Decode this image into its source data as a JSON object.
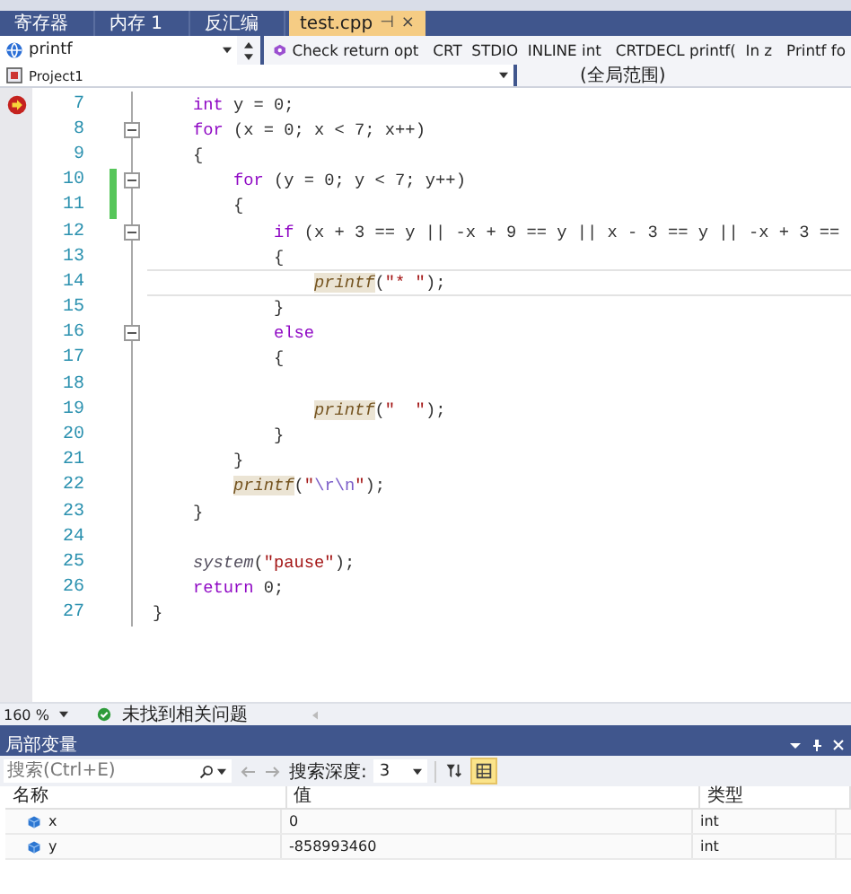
{
  "doc_tabs": [
    {
      "label": "寄存器",
      "selected": false
    },
    {
      "label": "内存 1",
      "selected": false
    },
    {
      "label": "反汇编",
      "selected": false
    },
    {
      "label": "test.cpp",
      "selected": true,
      "pin": "⊣",
      "close": "×"
    }
  ],
  "nav_bar": {
    "member": "printf",
    "signature": "Check return opt   CRT  STDIO  INLINE int   CRTDECL printf(  In z   Printf fo",
    "project": "Project1",
    "scope": "(全局范围)"
  },
  "code_lines": [
    {
      "number": "7",
      "next_statement": true,
      "fold": false,
      "modified": false,
      "current": false,
      "tokens": [
        {
          "kind": "kw",
          "text": "    int"
        },
        {
          "kind": "plain",
          "text": " y = 0;"
        }
      ]
    },
    {
      "number": "8",
      "next_statement": false,
      "fold": true,
      "modified": false,
      "current": false,
      "tokens": [
        {
          "kind": "kw",
          "text": "    for"
        },
        {
          "kind": "plain",
          "text": " (x = 0; x < 7; x++)"
        }
      ]
    },
    {
      "number": "9",
      "next_statement": false,
      "fold": false,
      "modified": false,
      "current": false,
      "tokens": [
        {
          "kind": "plain",
          "text": "    {"
        }
      ]
    },
    {
      "number": "10",
      "next_statement": false,
      "fold": true,
      "modified": true,
      "current": false,
      "tokens": [
        {
          "kind": "kw",
          "text": "        for"
        },
        {
          "kind": "plain",
          "text": " (y = 0; y < 7; y++)"
        }
      ]
    },
    {
      "number": "11",
      "next_statement": false,
      "fold": false,
      "modified": true,
      "current": false,
      "tokens": [
        {
          "kind": "plain",
          "text": "        {"
        }
      ]
    },
    {
      "number": "12",
      "next_statement": false,
      "fold": true,
      "modified": false,
      "current": false,
      "tokens": [
        {
          "kind": "kw",
          "text": "            if"
        },
        {
          "kind": "plain",
          "text": " (x + 3 == y || -x + 9 == y || x - 3 == y || -x + 3 =="
        }
      ]
    },
    {
      "number": "13",
      "next_statement": false,
      "fold": false,
      "modified": false,
      "current": false,
      "tokens": [
        {
          "kind": "plain",
          "text": "            {"
        }
      ]
    },
    {
      "number": "14",
      "next_statement": false,
      "fold": false,
      "modified": false,
      "current": true,
      "tokens": [
        {
          "kind": "fn-hl",
          "text": "                printf"
        },
        {
          "kind": "plain",
          "text": "("
        },
        {
          "kind": "str",
          "text": "\"* \""
        },
        {
          "kind": "plain",
          "text": ");"
        }
      ]
    },
    {
      "number": "15",
      "next_statement": false,
      "fold": false,
      "modified": false,
      "current": false,
      "tokens": [
        {
          "kind": "plain",
          "text": "            }"
        }
      ]
    },
    {
      "number": "16",
      "next_statement": false,
      "fold": true,
      "modified": false,
      "current": false,
      "tokens": [
        {
          "kind": "kw",
          "text": "            else"
        }
      ]
    },
    {
      "number": "17",
      "next_statement": false,
      "fold": false,
      "modified": false,
      "current": false,
      "tokens": [
        {
          "kind": "plain",
          "text": "            {"
        }
      ]
    },
    {
      "number": "18",
      "next_statement": false,
      "fold": false,
      "modified": false,
      "current": false
    },
    {
      "number": "19",
      "next_statement": false,
      "fold": false,
      "modified": false,
      "current": false,
      "tokens": [
        {
          "kind": "fn-hl",
          "text": "                printf"
        },
        {
          "kind": "plain",
          "text": "("
        },
        {
          "kind": "str",
          "text": "\"  \""
        },
        {
          "kind": "plain",
          "text": ");"
        }
      ]
    },
    {
      "number": "20",
      "next_statement": false,
      "fold": false,
      "modified": false,
      "current": false,
      "tokens": [
        {
          "kind": "plain",
          "text": "            }"
        }
      ]
    },
    {
      "number": "21",
      "next_statement": false,
      "fold": false,
      "modified": false,
      "current": false,
      "tokens": [
        {
          "kind": "plain",
          "text": "        }"
        }
      ]
    },
    {
      "number": "22",
      "next_statement": false,
      "fold": false,
      "modified": false,
      "current": false,
      "tokens": [
        {
          "kind": "fn-hl",
          "text": "        printf"
        },
        {
          "kind": "plain",
          "text": "("
        },
        {
          "kind": "str",
          "text": "\""
        },
        {
          "kind": "esc",
          "text": "\\r\\n"
        },
        {
          "kind": "str",
          "text": "\""
        },
        {
          "kind": "plain",
          "text": ");"
        }
      ]
    },
    {
      "number": "23",
      "next_statement": false,
      "fold": false,
      "modified": false,
      "current": false,
      "tokens": [
        {
          "kind": "plain",
          "text": "    }"
        }
      ]
    },
    {
      "number": "24",
      "next_statement": false,
      "fold": false,
      "modified": false,
      "current": false
    },
    {
      "number": "25",
      "next_statement": false,
      "fold": false,
      "modified": false,
      "current": false,
      "tokens": [
        {
          "kind": "fn",
          "text": "    system"
        },
        {
          "kind": "plain",
          "text": "("
        },
        {
          "kind": "str",
          "text": "\"pause\""
        },
        {
          "kind": "plain",
          "text": ");"
        }
      ]
    },
    {
      "number": "26",
      "next_statement": false,
      "fold": false,
      "modified": false,
      "current": false,
      "tokens": [
        {
          "kind": "kw",
          "text": "    return"
        },
        {
          "kind": "plain",
          "text": " 0;"
        }
      ]
    },
    {
      "number": "27",
      "next_statement": false,
      "fold": false,
      "modified": false,
      "current": false,
      "tokens": [
        {
          "kind": "plain",
          "text": "}"
        }
      ]
    }
  ],
  "status_bar": {
    "zoom": "160 %",
    "issues": "未找到相关问题"
  },
  "locals_panel": {
    "title": "局部变量",
    "search": {
      "placeholder": "搜索(Ctrl+E)"
    },
    "depth_label": "搜索深度:",
    "depth": "3",
    "columns": [
      "名称",
      "值",
      "类型"
    ],
    "rows": [
      {
        "name": "x",
        "value": "0",
        "type": "int"
      },
      {
        "name": "y",
        "value": "-858993460",
        "type": "int"
      }
    ]
  }
}
